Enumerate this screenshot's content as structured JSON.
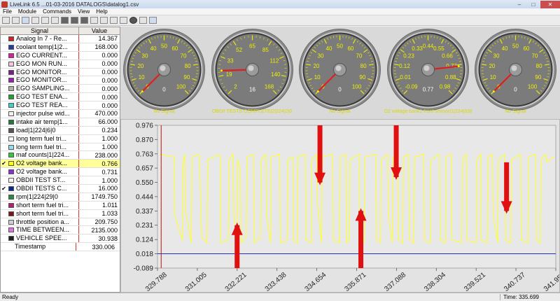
{
  "window": {
    "title": "LiveLink 6.5 ...01-03-2016 DATALOGS\\datalog1.csv",
    "min": "–",
    "max": "□",
    "close": "✕"
  },
  "menu": [
    "File",
    "Module",
    "Commands",
    "View",
    "Help"
  ],
  "signals": {
    "header_name": "Signal",
    "header_value": "Value",
    "rows": [
      {
        "checked": false,
        "color": "#d62020",
        "name": "Analog In 7 - Re...",
        "value": "14.367"
      },
      {
        "checked": false,
        "color": "#1a3fa8",
        "name": "coolant temp|1|2...",
        "value": "168.000"
      },
      {
        "checked": false,
        "color": "#e3199a",
        "name": "EGO CURRENT...",
        "value": "0.000"
      },
      {
        "checked": false,
        "color": "#f2c6e4",
        "name": "EGO MON RUN...",
        "value": "0.000"
      },
      {
        "checked": false,
        "color": "#7a1b8f",
        "name": "EGO MONITOR...",
        "value": "0.000"
      },
      {
        "checked": false,
        "color": "#9a1fb0",
        "name": "EGO MONITOR...",
        "value": "0.000"
      },
      {
        "checked": false,
        "color": "#b0b0b0",
        "name": "EGO SAMPLING...",
        "value": "0.000"
      },
      {
        "checked": false,
        "color": "#1fa32f",
        "name": "EGO TEST ENA...",
        "value": "0.000"
      },
      {
        "checked": false,
        "color": "#3ad0d0",
        "name": "EGO TEST REA...",
        "value": "0.000"
      },
      {
        "checked": false,
        "color": "#f2f2f2",
        "name": "injector pulse wid...",
        "value": "470.000"
      },
      {
        "checked": false,
        "color": "#1f7a3a",
        "name": "intake air temp|1...",
        "value": "66.000"
      },
      {
        "checked": false,
        "color": "#555555",
        "name": "load|1|224|6|0",
        "value": "0.234"
      },
      {
        "checked": false,
        "color": "#f4f4f4",
        "name": "long term fuel tri...",
        "value": "1.000"
      },
      {
        "checked": false,
        "color": "#8fe0e8",
        "name": "long term fuel tri...",
        "value": "1.000"
      },
      {
        "checked": false,
        "color": "#32c83c",
        "name": "maf counts|1|224...",
        "value": "238.000"
      },
      {
        "checked": true,
        "color": "#ffff00",
        "name": "O2 voltage bank...",
        "value": "0.766",
        "selected": true
      },
      {
        "checked": false,
        "color": "#8a2be2",
        "name": "O2 voltage bank...",
        "value": "0.731"
      },
      {
        "checked": false,
        "color": "#f5f5f5",
        "name": "OBDII TEST ST...",
        "value": "1.000"
      },
      {
        "checked": true,
        "color": "#0a2a8a",
        "name": "OBDII TESTS C...",
        "value": "16.000"
      },
      {
        "checked": false,
        "color": "#2a8a3a",
        "name": "rpm|1|224|29|0",
        "value": "1749.750"
      },
      {
        "checked": false,
        "color": "#b21f7a",
        "name": "short term fuel tri...",
        "value": "1.011"
      },
      {
        "checked": false,
        "color": "#7a1520",
        "name": "short term fuel tri...",
        "value": "1.033"
      },
      {
        "checked": false,
        "color": "#cfcfcf",
        "name": "throttle position a...",
        "value": "209.750"
      },
      {
        "checked": false,
        "color": "#e070e0",
        "name": "TIME BETWEEN...",
        "value": "2135.000"
      },
      {
        "checked": false,
        "color": "#1f1f1f",
        "name": "VEHICLE SPEE...",
        "value": "30.938"
      }
    ],
    "timestamp_label": "Timestamp",
    "timestamp_value": "330.006"
  },
  "gauges": [
    {
      "label": "No Signal",
      "value": "0",
      "ticks": [
        "0",
        "10",
        "20",
        "30",
        "40",
        "50",
        "60",
        "70",
        "80",
        "90",
        "100"
      ],
      "needle_fraction": 0.0
    },
    {
      "label": "OBDII TESTS COMPLETE|2|224|2|0",
      "value": "16",
      "ticks": [
        "2",
        "19",
        "33",
        "52",
        "65",
        "85",
        "112",
        "140",
        "168"
      ],
      "needle_fraction": 0.16
    },
    {
      "label": "No Signal",
      "value": "0",
      "ticks": [
        "0",
        "10",
        "20",
        "30",
        "40",
        "50",
        "60",
        "70",
        "80",
        "90",
        "100"
      ],
      "needle_fraction": 0.0
    },
    {
      "label": "O2 voltage bank1 front sensor|1|224|33|0",
      "value": "0.77",
      "ticks": [
        "-0.09",
        "0.01",
        "0.12",
        "0.23",
        "0.33",
        "0.44",
        "0.55",
        "0.66",
        "0.77",
        "0.88",
        "0.98"
      ],
      "needle_fraction": 0.81
    },
    {
      "label": "No Signal",
      "value": "0",
      "ticks": [
        "0",
        "10",
        "20",
        "30",
        "40",
        "50",
        "60",
        "70",
        "80",
        "90",
        "100"
      ],
      "needle_fraction": 0.0
    }
  ],
  "chart_data": {
    "type": "line",
    "xlabel": "",
    "ylabel": "",
    "y_ticks": [
      "0.976",
      "0.870",
      "0.763",
      "0.657",
      "0.550",
      "0.444",
      "0.337",
      "0.231",
      "0.124",
      "0.018",
      "-0.089"
    ],
    "x_ticks": [
      "329.788",
      "331.005",
      "332.221",
      "333.438",
      "334.654",
      "335.871",
      "337.088",
      "338.304",
      "339.521",
      "340.737",
      "341.954"
    ],
    "ylim": [
      -0.089,
      0.976
    ],
    "xlim": [
      329.788,
      341.954
    ],
    "series": [
      {
        "color": "#ffff33",
        "x": [
          329.85,
          330.3,
          330.32,
          330.55,
          330.57,
          330.62,
          330.64,
          330.82,
          330.84,
          331.05,
          331.07,
          331.12,
          331.14,
          331.3,
          331.32,
          331.7,
          331.72,
          331.95,
          331.97,
          332.1,
          332.12,
          332.22,
          332.24,
          332.32,
          332.34,
          332.5,
          332.52,
          332.72,
          332.74,
          332.93,
          332.95,
          333.1,
          333.12,
          333.24,
          333.26,
          333.52,
          333.54,
          333.75,
          333.77,
          333.92,
          333.94,
          334.06,
          334.08,
          334.3,
          334.32,
          334.48,
          334.5,
          334.65,
          334.67,
          334.8,
          334.82,
          335.14,
          335.16,
          335.35,
          335.37,
          335.54,
          335.56,
          335.65,
          335.67,
          335.95,
          335.97,
          336.1,
          336.12,
          336.46,
          336.48,
          336.6,
          336.62,
          336.82,
          336.84,
          336.96,
          336.98,
          337.12,
          337.14,
          337.28,
          337.3,
          337.46,
          337.48,
          337.62,
          337.64,
          337.92,
          337.94,
          338.12,
          338.14,
          338.4,
          338.42,
          338.58,
          338.6,
          338.76,
          338.78,
          339.08,
          339.1,
          339.22,
          339.24,
          339.52,
          339.54,
          339.66,
          339.68,
          339.86,
          339.88,
          340.02,
          340.04,
          340.18,
          340.2,
          340.4,
          340.42,
          340.58,
          340.6,
          340.88,
          340.9,
          341.1,
          341.12,
          341.34,
          341.36,
          341.48,
          341.5,
          341.65,
          341.67,
          341.9
        ],
        "values": [
          0.76,
          0.74,
          0.3,
          0.12,
          0.7,
          0.76,
          0.35,
          0.1,
          0.74,
          0.76,
          0.72,
          0.3,
          0.14,
          0.1,
          0.72,
          0.76,
          0.1,
          0.12,
          0.72,
          0.76,
          0.3,
          0.1,
          0.72,
          0.64,
          0.1,
          0.14,
          0.74,
          0.76,
          0.1,
          0.14,
          0.72,
          0.76,
          0.3,
          0.1,
          0.74,
          0.76,
          0.1,
          0.12,
          0.72,
          0.74,
          0.12,
          0.1,
          0.74,
          0.76,
          0.12,
          0.1,
          0.72,
          0.76,
          0.4,
          0.1,
          0.74,
          0.76,
          0.12,
          0.1,
          0.74,
          0.76,
          0.1,
          0.12,
          0.72,
          0.76,
          0.12,
          0.1,
          0.74,
          0.76,
          0.12,
          0.1,
          0.72,
          0.76,
          0.3,
          0.1,
          0.74,
          0.76,
          0.12,
          0.1,
          0.74,
          0.76,
          0.12,
          0.1,
          0.74,
          0.76,
          0.12,
          0.1,
          0.72,
          0.76,
          0.12,
          0.1,
          0.74,
          0.76,
          0.12,
          0.1,
          0.72,
          0.76,
          0.12,
          0.1,
          0.72,
          0.76,
          0.12,
          0.1,
          0.74,
          0.76,
          0.3,
          0.1,
          0.72,
          0.76,
          0.12,
          0.1,
          0.72,
          0.76,
          0.12,
          0.1,
          0.74,
          0.76,
          0.12,
          0.1,
          0.72,
          0.76,
          0.7,
          0.74
        ]
      },
      {
        "color": "#2230c8",
        "x": [
          329.788,
          341.954
        ],
        "values": [
          0.018,
          0.018
        ]
      }
    ],
    "cursor_x": 329.9,
    "arrows": [
      {
        "x": 332.22,
        "from_y": -0.089,
        "to_y": 0.231,
        "direction": "up"
      },
      {
        "x": 334.75,
        "from_y": 0.976,
        "to_y": 0.55,
        "direction": "down"
      },
      {
        "x": 336.0,
        "from_y": -0.089,
        "to_y": 0.337,
        "direction": "up"
      },
      {
        "x": 337.08,
        "from_y": 0.976,
        "to_y": 0.59,
        "direction": "down"
      },
      {
        "x": 340.45,
        "from_y": 0.7,
        "to_y": 0.337,
        "direction": "down"
      }
    ]
  },
  "status": {
    "left": "Ready",
    "right": "Time: 335.699"
  }
}
